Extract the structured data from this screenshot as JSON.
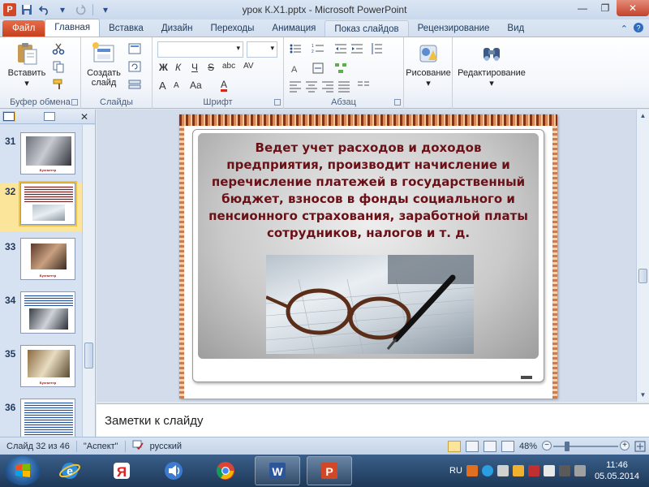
{
  "window": {
    "title": "урок К.Х1.pptx  -  Microsoft PowerPoint",
    "app_letter": "P",
    "minimize": "—",
    "maximize": "❐",
    "close": "✕"
  },
  "tabs": {
    "file": "Файл",
    "items": [
      "Главная",
      "Вставка",
      "Дизайн",
      "Переходы",
      "Анимация",
      "Показ слайдов",
      "Рецензирование",
      "Вид"
    ]
  },
  "ribbon": {
    "clipboard": {
      "label": "Буфер обмена",
      "paste": "Вставить",
      "paste_arrow": "▾"
    },
    "slides": {
      "label": "Слайды",
      "new_slide_line1": "Создать",
      "new_slide_line2": "слайд",
      "arrow": "▾"
    },
    "font": {
      "label": "Шрифт",
      "bold": "Ж",
      "italic": "К",
      "underline": "Ч",
      "strike": "S",
      "shadow": "abc",
      "spacing": "AV",
      "case": "Aa",
      "color": "A",
      "grow": "A",
      "shrink": "A"
    },
    "paragraph": {
      "label": "Абзац"
    },
    "drawing": {
      "label": "Рисование",
      "arrow": "▾"
    },
    "editing": {
      "label": "Редактирование",
      "arrow": "▾"
    }
  },
  "thumbnails": [
    {
      "number": "31",
      "caption": "Бухгалтер"
    },
    {
      "number": "32",
      "caption": "",
      "selected": true
    },
    {
      "number": "33",
      "caption": "Бухгалтер"
    },
    {
      "number": "34",
      "caption": ""
    },
    {
      "number": "35",
      "caption": "Бухгалтер"
    },
    {
      "number": "36",
      "caption": ""
    }
  ],
  "slide": {
    "text": "Ведет учет расходов и доходов предприятия, производит начисление и перечисление платежей в государственный бюджет, взносов в фонды социального и пенсионного страхования, заработной платы сотрудников, налогов и т.  д."
  },
  "notes": {
    "placeholder": "Заметки к слайду"
  },
  "statusbar": {
    "slide_counter": "Слайд 32 из 46",
    "theme": "\"Аспект\"",
    "language": "русский",
    "zoom_percent": "48%",
    "zoom_value": 0.48,
    "zoom_minus": "−",
    "zoom_plus": "+"
  },
  "taskbar": {
    "language": "RU",
    "time": "11:46",
    "date": "05.05.2014",
    "apps": [
      "Internet Explorer",
      "Яндекс",
      "Media",
      "Google Chrome",
      "Microsoft Word",
      "Microsoft PowerPoint"
    ],
    "yandex_letter": "Я",
    "word_letter": "W",
    "ppt_letter": "P"
  },
  "colors": {
    "slide_text": "#6a1017",
    "file_tab": "#c5401f",
    "selected_thumb": "#fbe59a"
  }
}
